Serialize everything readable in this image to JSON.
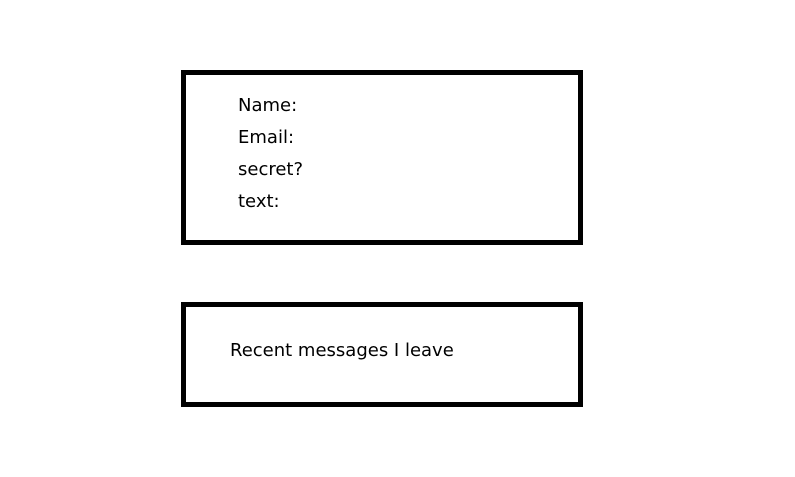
{
  "form": {
    "fields": [
      {
        "label": "Name:"
      },
      {
        "label": "Email:"
      },
      {
        "label": "secret?"
      },
      {
        "label": "text:"
      }
    ]
  },
  "messages": {
    "label": "Recent messages I leave"
  }
}
